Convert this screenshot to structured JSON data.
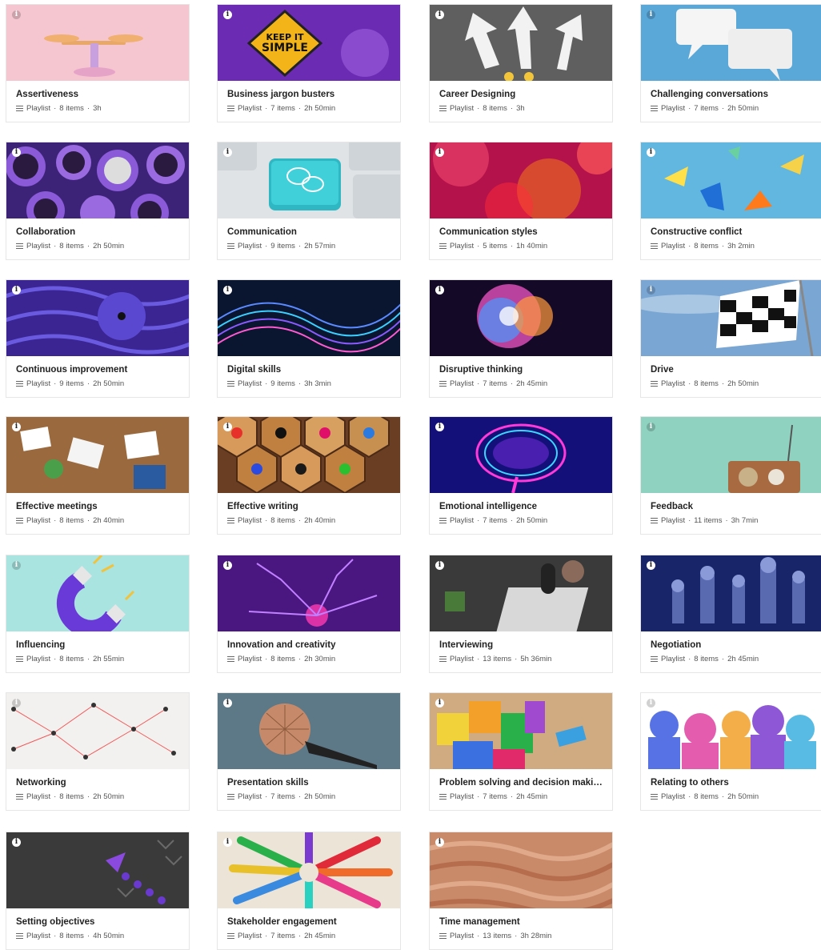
{
  "cards": [
    {
      "title": "Assertiveness",
      "type": "Playlist",
      "items": "8 items",
      "duration": "3h",
      "image_icon": "balance-scale-icon",
      "bg": "#f7c9d3"
    },
    {
      "title": "Business jargon busters",
      "type": "Playlist",
      "items": "7 items",
      "duration": "2h 50min",
      "image_icon": "keep-it-simple-sign-icon",
      "bg": "#6a2bb0"
    },
    {
      "title": "Career Designing",
      "type": "Playlist",
      "items": "8 items",
      "duration": "3h",
      "image_icon": "road-arrows-icon",
      "bg": "#5d5d5d"
    },
    {
      "title": "Challenging conversations",
      "type": "Playlist",
      "items": "7 items",
      "duration": "2h 50min",
      "image_icon": "speech-bubbles-icon",
      "bg": "#5ba9d8"
    },
    {
      "title": "Collaboration",
      "type": "Playlist",
      "items": "8 items",
      "duration": "2h 50min",
      "image_icon": "coffee-cups-icon",
      "bg": "#4a2a8a"
    },
    {
      "title": "Communication",
      "type": "Playlist",
      "items": "9 items",
      "duration": "2h 57min",
      "image_icon": "keyboard-chat-key-icon",
      "bg": "#d9dde0"
    },
    {
      "title": "Communication styles",
      "type": "Playlist",
      "items": "5 items",
      "duration": "1h 40min",
      "image_icon": "bokeh-lights-icon",
      "bg": "#c0154f"
    },
    {
      "title": "Constructive conflict",
      "type": "Playlist",
      "items": "8 items",
      "duration": "3h 2min",
      "image_icon": "paper-birds-icon",
      "bg": "#5fb6e0"
    },
    {
      "title": "Continuous improvement",
      "type": "Playlist",
      "items": "9 items",
      "duration": "2h 50min",
      "image_icon": "pinwheel-icon",
      "bg": "#3a2390"
    },
    {
      "title": "Digital skills",
      "type": "Playlist",
      "items": "9 items",
      "duration": "3h 3min",
      "image_icon": "data-wave-icon",
      "bg": "#0d1a3a"
    },
    {
      "title": "Disruptive thinking",
      "type": "Playlist",
      "items": "7 items",
      "duration": "2h 45min",
      "image_icon": "color-explosion-icon",
      "bg": "#1a1030"
    },
    {
      "title": "Drive",
      "type": "Playlist",
      "items": "8 items",
      "duration": "2h 50min",
      "image_icon": "checkered-flag-icon",
      "bg": "#6f9fcf"
    },
    {
      "title": "Effective meetings",
      "type": "Playlist",
      "items": "8 items",
      "duration": "2h 40min",
      "image_icon": "meeting-table-icon",
      "bg": "#9a6a3e"
    },
    {
      "title": "Effective writing",
      "type": "Playlist",
      "items": "8 items",
      "duration": "2h 40min",
      "image_icon": "colored-pencils-icon",
      "bg": "#7a4a2a"
    },
    {
      "title": "Emotional intelligence",
      "type": "Playlist",
      "items": "7 items",
      "duration": "2h 50min",
      "image_icon": "neon-brain-icon",
      "bg": "#14107a"
    },
    {
      "title": "Feedback",
      "type": "Playlist",
      "items": "11 items",
      "duration": "3h 7min",
      "image_icon": "radio-icon",
      "bg": "#6fc0ad"
    },
    {
      "title": "Influencing",
      "type": "Playlist",
      "items": "8 items",
      "duration": "2h 55min",
      "image_icon": "magnet-icon",
      "bg": "#a6e3e0"
    },
    {
      "title": "Innovation and creativity",
      "type": "Playlist",
      "items": "8 items",
      "duration": "2h 30min",
      "image_icon": "plasma-ball-icon",
      "bg": "#5a1a8a"
    },
    {
      "title": "Interviewing",
      "type": "Playlist",
      "items": "13 items",
      "duration": "5h 36min",
      "image_icon": "podcast-microphone-icon",
      "bg": "#3a3a3a"
    },
    {
      "title": "Negotiation",
      "type": "Playlist",
      "items": "8 items",
      "duration": "2h 45min",
      "image_icon": "chess-pieces-icon",
      "bg": "#1c2a6a"
    },
    {
      "title": "Networking",
      "type": "Playlist",
      "items": "8 items",
      "duration": "2h 50min",
      "image_icon": "network-pins-icon",
      "bg": "#f2f0ee"
    },
    {
      "title": "Presentation skills",
      "type": "Playlist",
      "items": "7 items",
      "duration": "2h 50min",
      "image_icon": "microphone-icon",
      "bg": "#4a6070"
    },
    {
      "title": "Problem solving and decision making",
      "type": "Playlist",
      "items": "7 items",
      "duration": "2h 45min",
      "image_icon": "puzzle-blocks-icon",
      "bg": "#c7a178"
    },
    {
      "title": "Relating to others",
      "type": "Playlist",
      "items": "8 items",
      "duration": "2h 50min",
      "image_icon": "silhouettes-icon",
      "bg": "#ffffff"
    },
    {
      "title": "Setting objectives",
      "type": "Playlist",
      "items": "8 items",
      "duration": "4h 50min",
      "image_icon": "chalkboard-arrow-icon",
      "bg": "#3a3a3a"
    },
    {
      "title": "Stakeholder engagement",
      "type": "Playlist",
      "items": "7 items",
      "duration": "2h 45min",
      "image_icon": "pencil-circle-icon",
      "bg": "#e9e1d4"
    },
    {
      "title": "Time management",
      "type": "Playlist",
      "items": "13 items",
      "duration": "3h 28min",
      "image_icon": "sandstone-icon",
      "bg": "#c88a6a"
    }
  ]
}
